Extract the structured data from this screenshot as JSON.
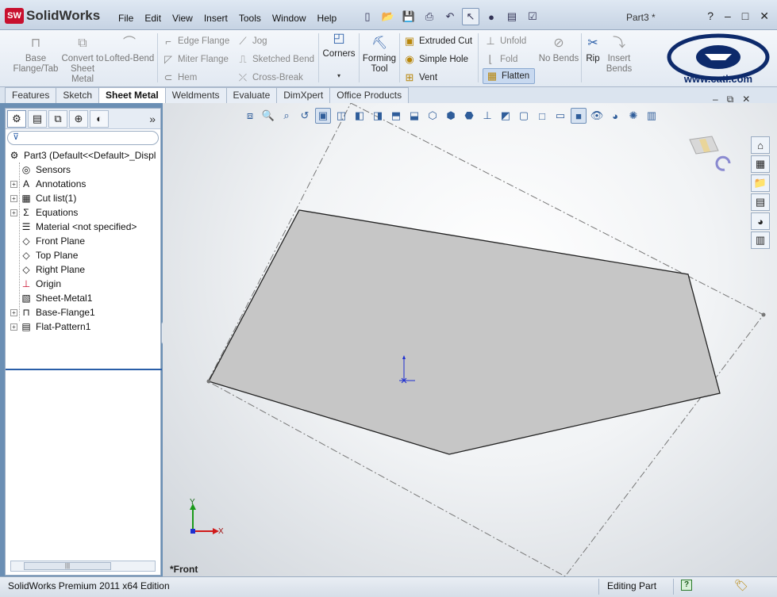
{
  "app": {
    "logo_text": "SolidWorks",
    "logo_badge": "SW",
    "doc_title": "Part3 *"
  },
  "menu": [
    "File",
    "Edit",
    "View",
    "Insert",
    "Tools",
    "Window",
    "Help"
  ],
  "ribbon": {
    "base_flange": "Base Flange/Tab",
    "convert": "Convert to Sheet Metal",
    "lofted_bend": "Lofted-Bend",
    "edge_flange": "Edge Flange",
    "miter_flange": "Miter Flange",
    "hem": "Hem",
    "jog": "Jog",
    "sketched_bend": "Sketched Bend",
    "cross_break": "Cross-Break",
    "corners": "Corners",
    "forming_tool": "Forming Tool",
    "extruded_cut": "Extruded Cut",
    "simple_hole": "Simple Hole",
    "vent": "Vent",
    "unfold": "Unfold",
    "fold": "Fold",
    "flatten": "Flatten",
    "no_bends": "No Bends",
    "rip": "Rip",
    "insert_bends": "Insert Bends",
    "cati_url": "www.cati.com"
  },
  "tabs": [
    "Features",
    "Sketch",
    "Sheet Metal",
    "Weldments",
    "Evaluate",
    "DimXpert",
    "Office Products"
  ],
  "active_tab": "Sheet Metal",
  "tree": {
    "root": "Part3  (Default<<Default>_Displ",
    "items": [
      {
        "label": "Sensors",
        "icon": "sensor-icon",
        "expandable": false
      },
      {
        "label": "Annotations",
        "icon": "annotations-icon",
        "expandable": true
      },
      {
        "label": "Cut list(1)",
        "icon": "cut-list-icon",
        "expandable": true
      },
      {
        "label": "Equations",
        "icon": "equations-icon",
        "expandable": true
      },
      {
        "label": "Material <not specified>",
        "icon": "material-icon",
        "expandable": false
      },
      {
        "label": "Front Plane",
        "icon": "plane-icon",
        "expandable": false
      },
      {
        "label": "Top Plane",
        "icon": "plane-icon",
        "expandable": false
      },
      {
        "label": "Right Plane",
        "icon": "plane-icon",
        "expandable": false
      },
      {
        "label": "Origin",
        "icon": "origin-icon",
        "expandable": false
      },
      {
        "label": "Sheet-Metal1",
        "icon": "sheet-metal-icon",
        "expandable": false
      },
      {
        "label": "Base-Flange1",
        "icon": "base-flange-icon",
        "expandable": true
      },
      {
        "label": "Flat-Pattern1",
        "icon": "flat-pattern-icon",
        "expandable": true
      }
    ]
  },
  "graphics": {
    "view_name": "*Front",
    "triad_x": "X",
    "triad_y": "Y"
  },
  "status": {
    "edition": "SolidWorks Premium 2011 x64 Edition",
    "mode": "Editing Part",
    "help": "?"
  }
}
